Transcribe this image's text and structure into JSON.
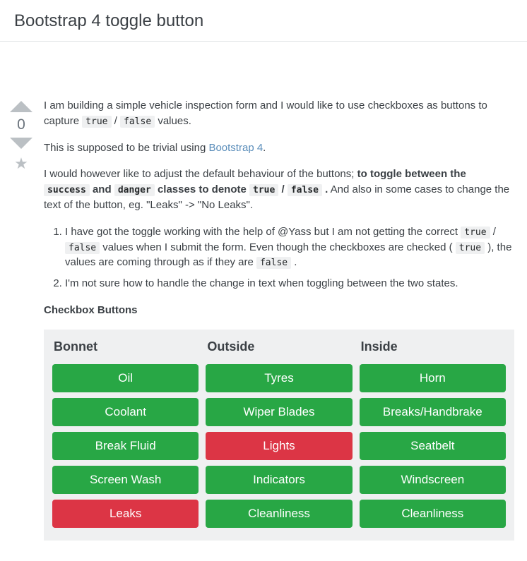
{
  "title": "Bootstrap 4 toggle button",
  "vote": {
    "count": "0"
  },
  "codes": {
    "true": "true",
    "false": "false",
    "success": "success",
    "danger": "danger"
  },
  "body": {
    "p1a": "I am building a simple vehicle inspection form and I would like to use checkboxes as buttons to capture ",
    "p1b": " / ",
    "p1c": " values.",
    "p2a": "This is supposed to be trivial using ",
    "p2link": "Bootstrap 4",
    "p2b": ".",
    "p3a": "I would however like to adjust the default behaviour of the buttons; ",
    "p3b": "to toggle between the ",
    "p3c": " and ",
    "p3d": " classes to denote ",
    "p3e": " / ",
    "p3f": " .",
    "p3g": " And also in some cases to change the text of the button, eg. \"Leaks\" -> \"No Leaks\".",
    "li1a": "I have got the toggle working with the help of @Yass but I am not getting the correct ",
    "li1b": " / ",
    "li1c": " values when I submit the form. Even though the checkboxes are checked ( ",
    "li1d": " ), the values are coming through as if they are ",
    "li1e": " .",
    "li2": "I'm not sure how to handle the change in text when toggling between the two states.",
    "heading": "Checkbox Buttons"
  },
  "embed": {
    "cols": [
      {
        "title": "Bonnet",
        "items": [
          {
            "label": "Oil",
            "style": "success"
          },
          {
            "label": "Coolant",
            "style": "success"
          },
          {
            "label": "Break Fluid",
            "style": "success"
          },
          {
            "label": "Screen Wash",
            "style": "success"
          },
          {
            "label": "Leaks",
            "style": "danger"
          }
        ]
      },
      {
        "title": "Outside",
        "items": [
          {
            "label": "Tyres",
            "style": "success"
          },
          {
            "label": "Wiper Blades",
            "style": "success"
          },
          {
            "label": "Lights",
            "style": "danger"
          },
          {
            "label": "Indicators",
            "style": "success"
          },
          {
            "label": "Cleanliness",
            "style": "success"
          }
        ]
      },
      {
        "title": "Inside",
        "items": [
          {
            "label": "Horn",
            "style": "success"
          },
          {
            "label": "Breaks/Handbrake",
            "style": "success"
          },
          {
            "label": "Seatbelt",
            "style": "success"
          },
          {
            "label": "Windscreen",
            "style": "success"
          },
          {
            "label": "Cleanliness",
            "style": "success"
          }
        ]
      }
    ]
  }
}
